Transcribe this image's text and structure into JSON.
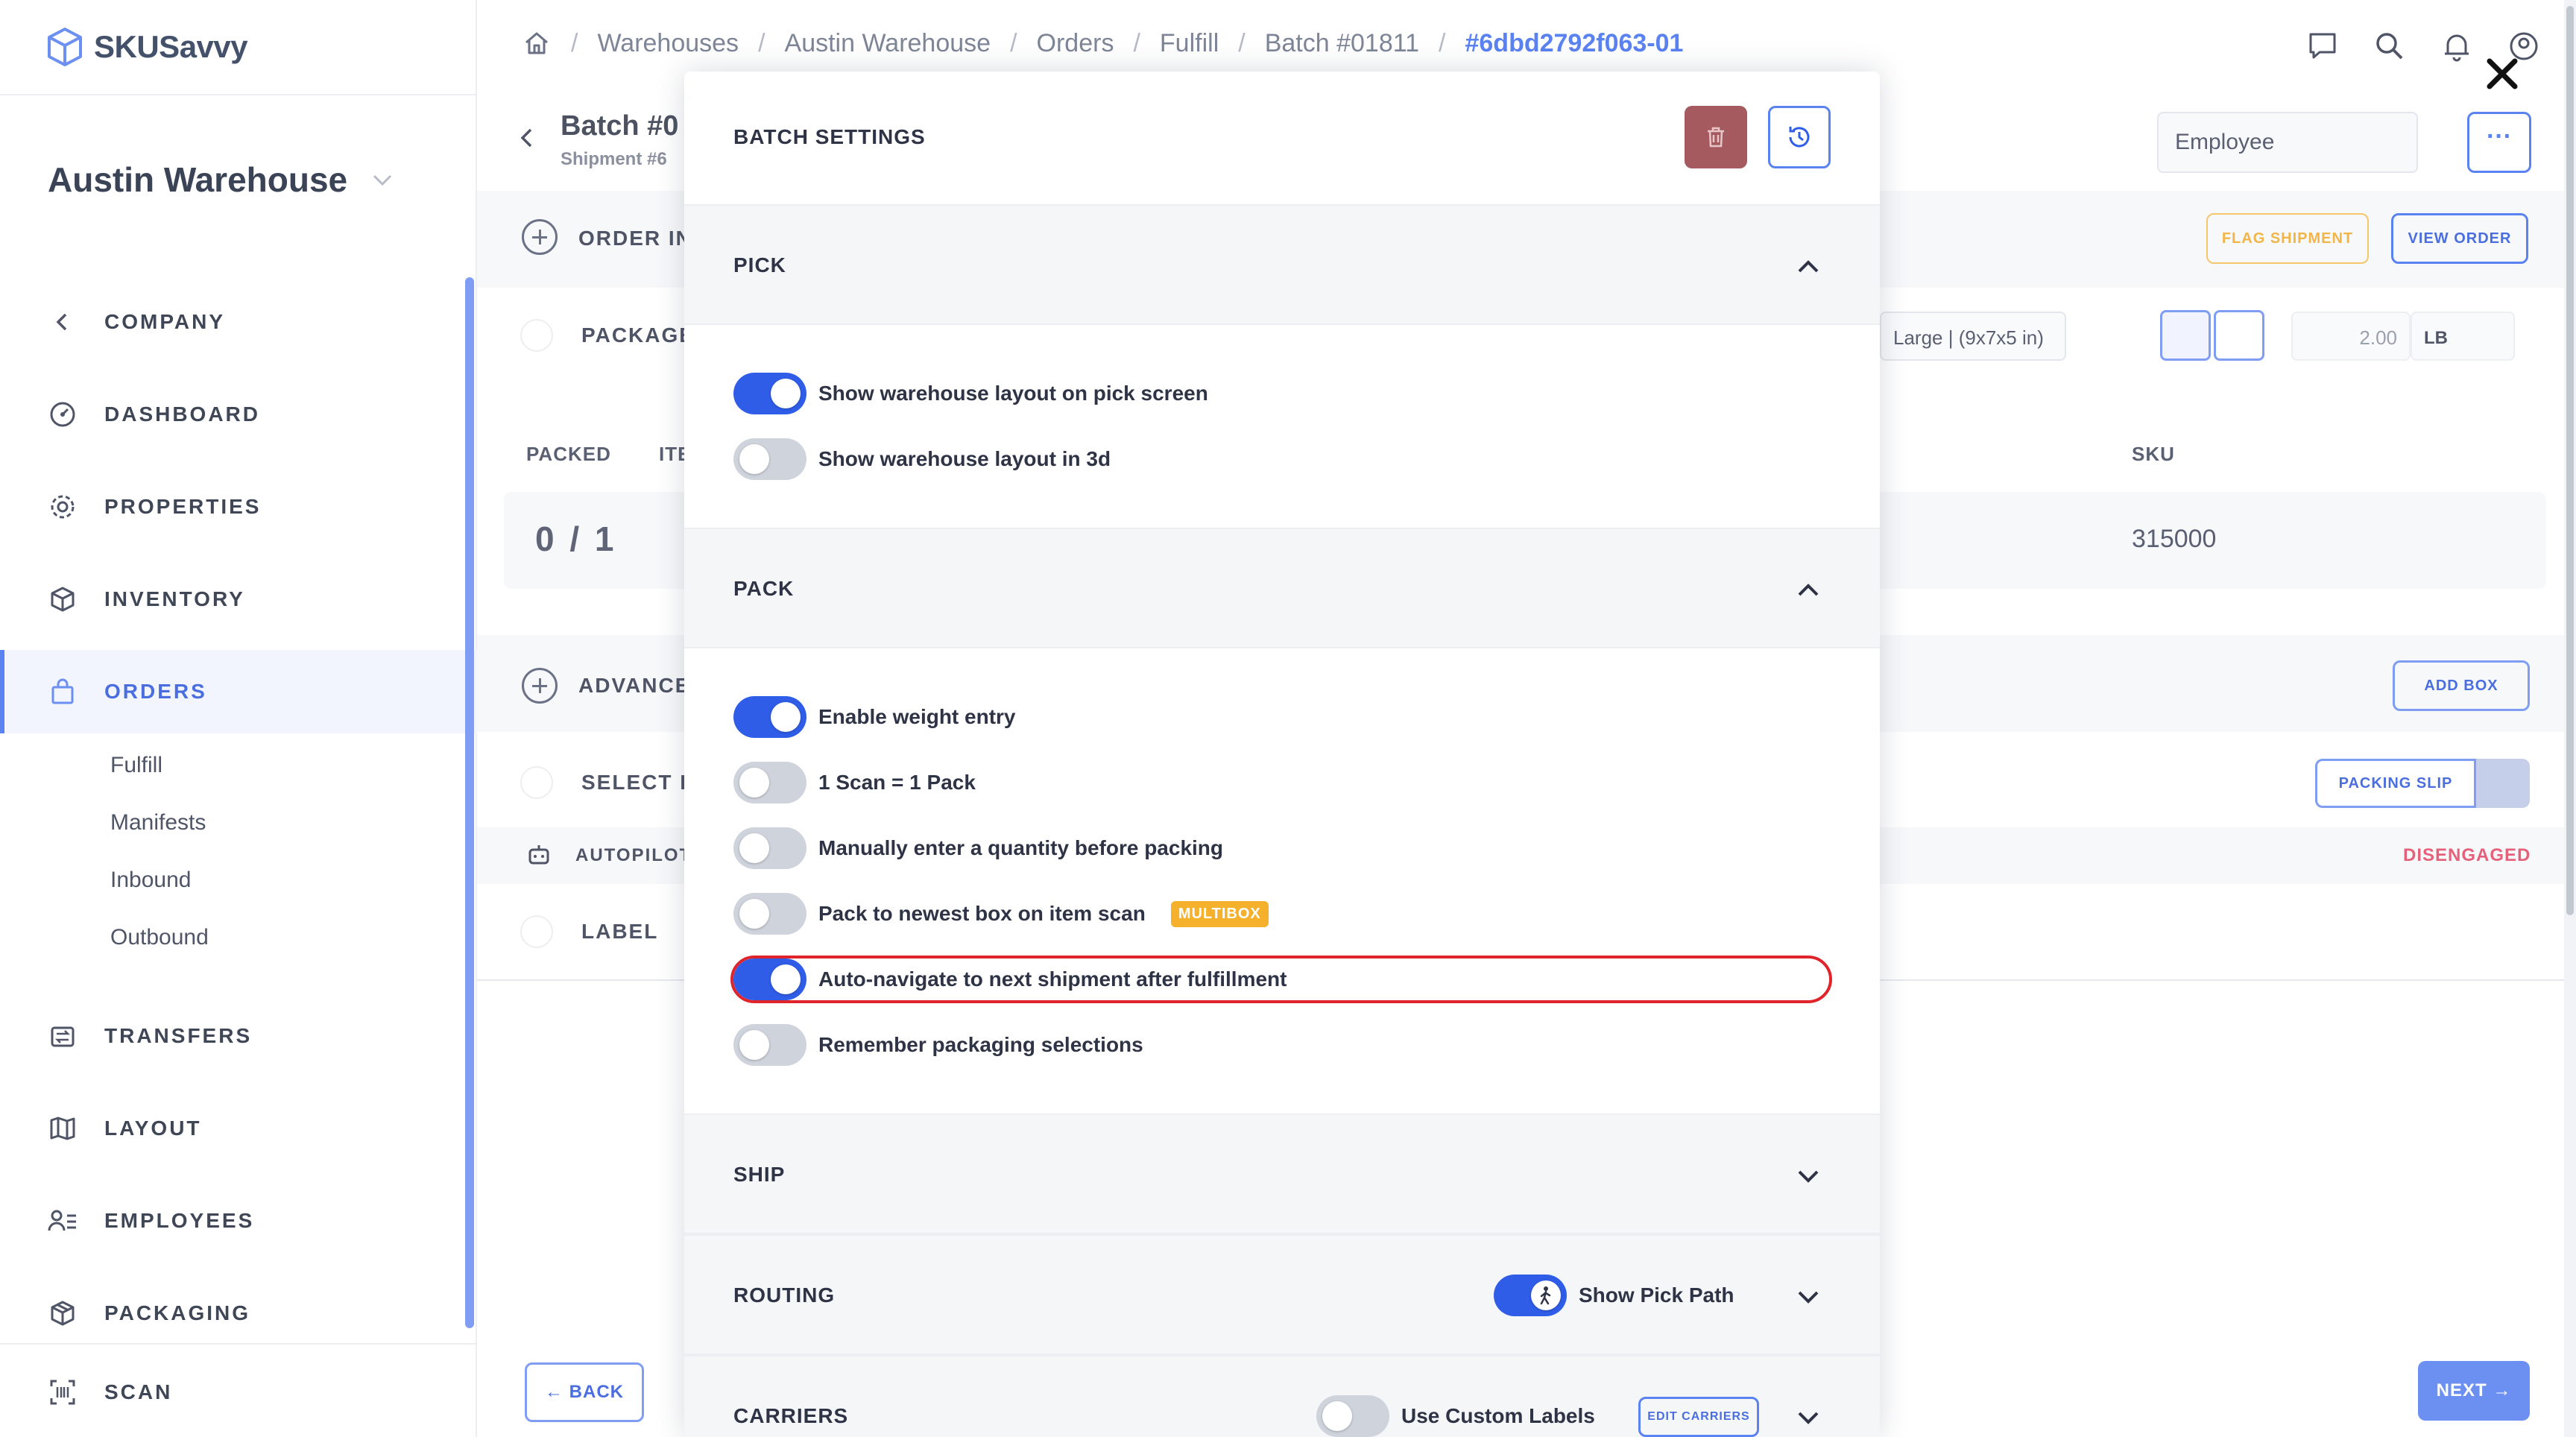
{
  "app": {
    "brand": "SKUSavvy",
    "warehouse": "Austin Warehouse"
  },
  "sidebar": {
    "items": [
      {
        "label": "COMPANY",
        "icon": "chevron-left-icon"
      },
      {
        "label": "DASHBOARD",
        "icon": "dashboard-icon"
      },
      {
        "label": "PROPERTIES",
        "icon": "gear-icon"
      },
      {
        "label": "INVENTORY",
        "icon": "box-icon"
      },
      {
        "label": "ORDERS",
        "icon": "bag-icon"
      },
      {
        "label": "TRANSFERS",
        "icon": "transfer-icon"
      },
      {
        "label": "LAYOUT",
        "icon": "map-icon"
      },
      {
        "label": "EMPLOYEES",
        "icon": "employees-icon"
      },
      {
        "label": "PACKAGING",
        "icon": "package-icon"
      },
      {
        "label": "SCAN",
        "icon": "scan-icon"
      }
    ],
    "order_subitems": [
      "Fulfill",
      "Manifests",
      "Inbound",
      "Outbound"
    ]
  },
  "breadcrumb": [
    "Warehouses",
    "Austin Warehouse",
    "Orders",
    "Fulfill",
    "Batch #01811",
    "#6dbd2792f063-01"
  ],
  "background": {
    "batch_title": "Batch #0",
    "shipment_sub": "Shipment #6",
    "order_info": "ORDER IN",
    "package": "PACKAGE",
    "packed_head": "PACKED",
    "item_head": "ITE",
    "packed_count": "0 / 1",
    "advanced": "ADVANCE",
    "select_rate": "SELECT R",
    "autopilot": "AUTOPILOT",
    "label": "LABEL",
    "employee_select": "Employee",
    "more": "···",
    "flag_shipment": "FLAG SHIPMENT",
    "view_order": "VIEW ORDER",
    "box_select": "Large | (9x7x5 in)",
    "weight_value": "2.00",
    "weight_unit": "LB",
    "sku_head": "SKU",
    "sku_value": "315000",
    "add_box": "ADD BOX",
    "packing_slip": "PACKING SLIP",
    "disengaged": "DISENGAGED",
    "back": "BACK",
    "next": "NEXT"
  },
  "modal": {
    "title": "BATCH SETTINGS",
    "sections": {
      "pick": {
        "title": "PICK",
        "toggles": [
          {
            "label": "Show warehouse layout on pick screen",
            "on": true
          },
          {
            "label": "Show warehouse layout in 3d",
            "on": false
          }
        ]
      },
      "pack": {
        "title": "PACK",
        "toggles": [
          {
            "label": "Enable weight entry",
            "on": true
          },
          {
            "label": "1 Scan = 1 Pack",
            "on": false
          },
          {
            "label": "Manually enter a quantity before packing",
            "on": false
          },
          {
            "label": "Pack to newest box on item scan",
            "on": false,
            "badge": "MULTIBOX"
          },
          {
            "label": "Auto-navigate to next shipment after fulfillment",
            "on": true
          },
          {
            "label": "Remember packaging selections",
            "on": false
          }
        ]
      },
      "ship": {
        "title": "SHIP"
      },
      "routing": {
        "title": "ROUTING",
        "toggle_label": "Show Pick Path",
        "toggle_on": true
      },
      "carriers": {
        "title": "CARRIERS",
        "toggle_label": "Use Custom Labels",
        "toggle_on": false,
        "edit_label": "EDIT CARRIERS"
      }
    }
  },
  "colors": {
    "accent": "#2f5de8",
    "danger": "#a45a5f",
    "highlight": "#e0242c",
    "badge": "#f5b12b"
  }
}
